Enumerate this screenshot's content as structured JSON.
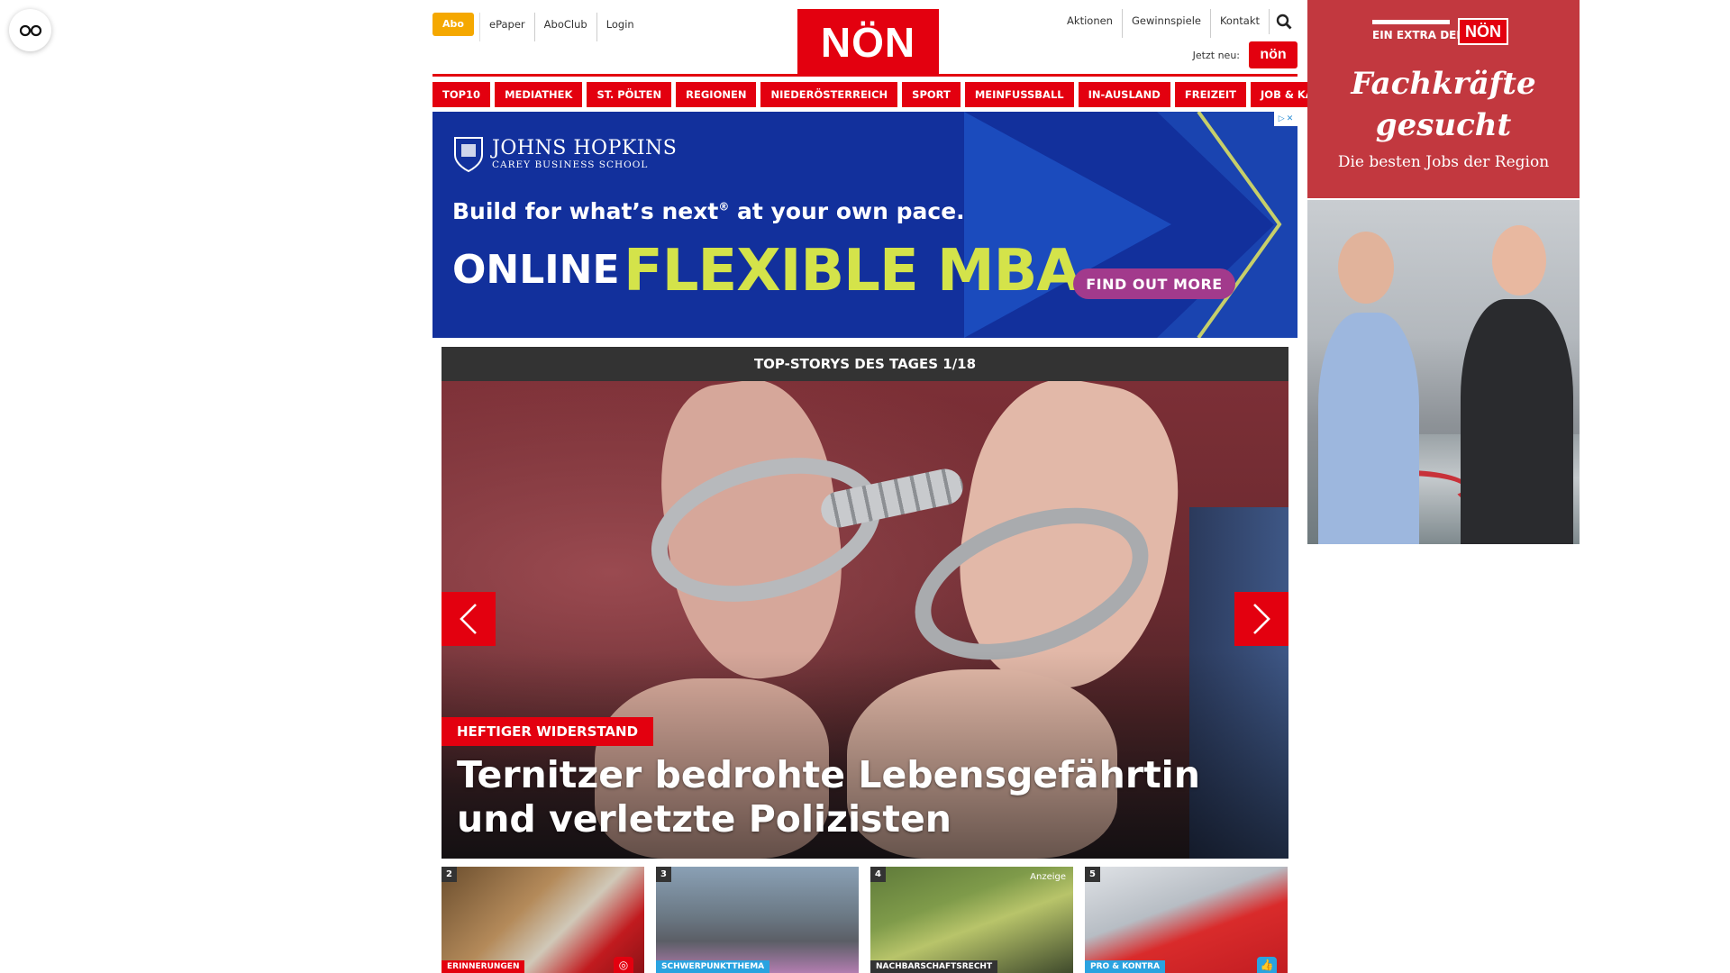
{
  "topbar": {
    "abo": "Abo",
    "meta_left": [
      "ePaper",
      "AboClub",
      "Login"
    ],
    "logo": "NÖN",
    "meta_right": [
      "Aktionen",
      "Gewinnspiele",
      "Kontakt"
    ],
    "jetzt_neu": "Jetzt neu:",
    "mini_logo": "nön"
  },
  "nav": [
    "TOP10",
    "MEDIATHEK",
    "ST. PÖLTEN",
    "REGIONEN",
    "NIEDERÖSTERREICH",
    "SPORT",
    "MEINFUSSBALL",
    "IN-AUSLAND",
    "FREIZEIT",
    "JOB & KARRIERE"
  ],
  "ad": {
    "uni_name": "JOHNS HOPKINS",
    "uni_sub": "CAREY BUSINESS SCHOOL",
    "line1": "Build for what’s next",
    "line1_sup": "®",
    "line1_end": " at your own pace.",
    "online": "ONLINE",
    "mba": "FLEXIBLE MBA",
    "cta": "FIND OUT MORE"
  },
  "stories": {
    "header": "TOP-STORYS DES TAGES 1/18",
    "kicker": "HEFTIGER WIDERSTAND",
    "headline": "Ternitzer bedrohte Lebensgefährtin und verletzte Polizisten",
    "thumbs": [
      {
        "num": "2",
        "tag": "ERINNERUNGEN",
        "tag_color": "#e3000f",
        "icon": "instagram-icon"
      },
      {
        "num": "3",
        "tag": "SCHWERPUNKTTHEMA",
        "tag_color": "#2aa3e0",
        "icon": ""
      },
      {
        "num": "4",
        "tag": "NACHBARSCHAFTSRECHT",
        "tag_color": "#333333",
        "icon": "",
        "anzeige": "Anzeige"
      },
      {
        "num": "5",
        "tag": "PRO & KONTRA",
        "tag_color": "#2aa3e0",
        "icon": "thumbs-up-icon"
      }
    ]
  },
  "side_ad": {
    "brand_text": "EIN EXTRA DER",
    "brand_logo": "NÖN",
    "headline_1": "Fachkräfte",
    "headline_2": "gesucht",
    "sub": "Die besten Jobs der Region"
  },
  "colors": {
    "brand_red": "#e3000f",
    "abo_orange": "#f5a800",
    "ad_blue": "#12309c",
    "ad_lime": "#d4e34a",
    "cta_purple": "#a23a8c",
    "side_ad_red": "#c2383f"
  }
}
